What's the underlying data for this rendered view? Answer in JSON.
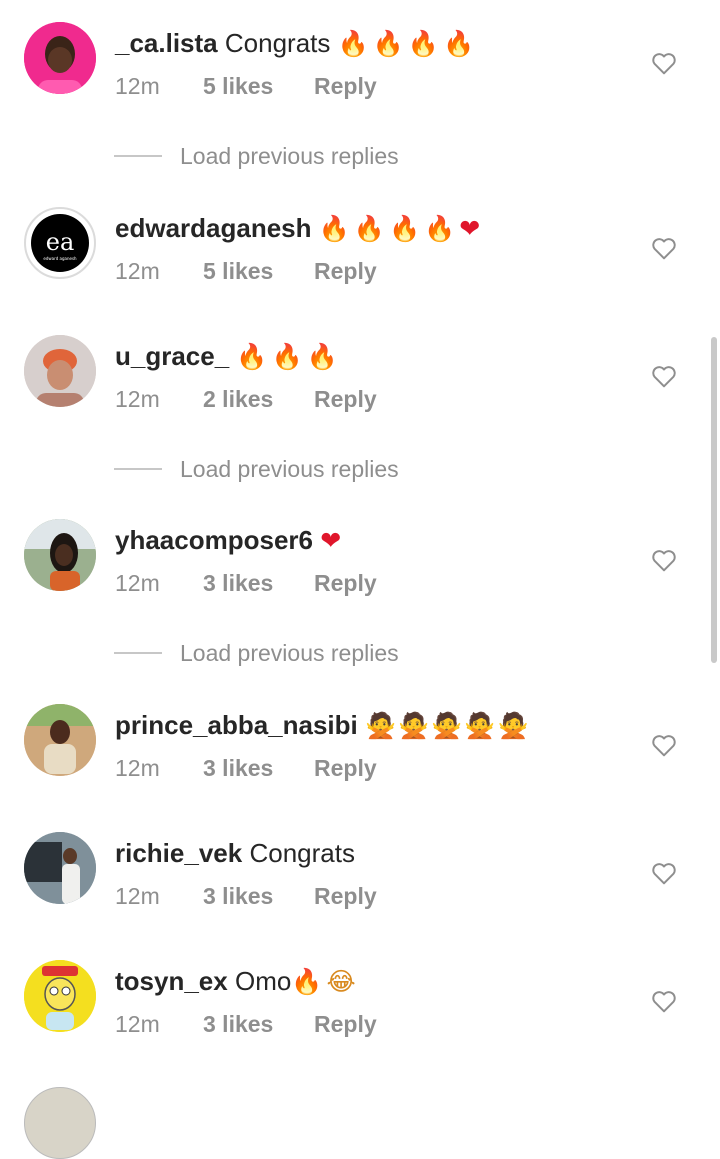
{
  "comments": [
    {
      "username": "_ca.lista",
      "text": "Congrats",
      "emoji": "🔥🔥🔥🔥",
      "time": "12m",
      "likes": "5 likes",
      "reply": "Reply"
    },
    {
      "username": "edwardaganesh",
      "text": "",
      "emoji": "🔥🔥🔥🔥",
      "emoji_heart": "❤",
      "time": "12m",
      "likes": "5 likes",
      "reply": "Reply",
      "avatar_text": "ea",
      "avatar_subtext": "edward aganesh"
    },
    {
      "username": "u_grace_",
      "text": "",
      "emoji": "🔥🔥🔥",
      "time": "12m",
      "likes": "2 likes",
      "reply": "Reply"
    },
    {
      "username": "yhaacomposer6",
      "text": "",
      "emoji_heart": "❤",
      "time": "12m",
      "likes": "3 likes",
      "reply": "Reply"
    },
    {
      "username": "prince_abba_nasibi",
      "text": "",
      "emoji": "🙅🙅🙅🙅🙅",
      "time": "12m",
      "likes": "3 likes",
      "reply": "Reply"
    },
    {
      "username": "richie_vek",
      "text": "Congrats",
      "time": "12m",
      "likes": "3 likes",
      "reply": "Reply"
    },
    {
      "username": "tosyn_ex",
      "text": "Omo",
      "emoji": "🔥",
      "emoji_face": "😂",
      "time": "12m",
      "likes": "3 likes",
      "reply": "Reply"
    }
  ],
  "load_previous_replies": "Load previous replies",
  "colors": {
    "muted": "#8e8e8e",
    "text": "#262626",
    "fire": "#e0651a",
    "heart": "#e0162b"
  }
}
